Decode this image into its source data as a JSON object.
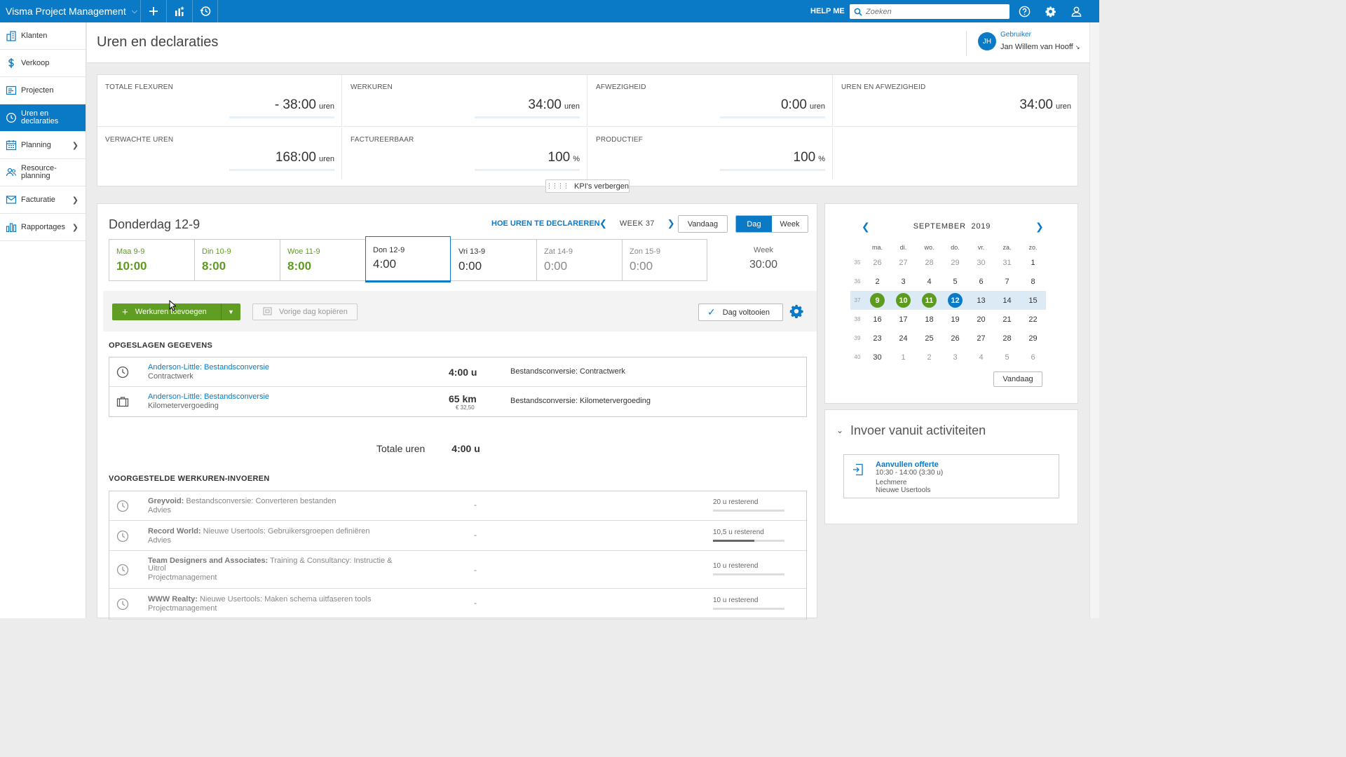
{
  "app": {
    "title": "Visma Project Management",
    "help": "HELP ME",
    "search_placeholder": "Zoeken"
  },
  "sidebar": {
    "items": [
      {
        "label": "Klanten",
        "icon": "building-icon"
      },
      {
        "label": "Verkoop",
        "icon": "dollar-icon"
      },
      {
        "label": "Projecten",
        "icon": "project-icon"
      },
      {
        "label": "Uren en declaraties",
        "icon": "clock-icon",
        "active": true
      },
      {
        "label": "Planning",
        "icon": "calendar-icon",
        "has_sub": true
      },
      {
        "label": "Resource-planning",
        "icon": "people-icon"
      },
      {
        "label": "Facturatie",
        "icon": "invoice-icon",
        "has_sub": true
      },
      {
        "label": "Rapportages",
        "icon": "chart-icon",
        "has_sub": true
      }
    ]
  },
  "header": {
    "title": "Uren en declaraties",
    "user_role": "Gebruiker",
    "user_name": "Jan Willem van Hooff",
    "initials": "JH"
  },
  "kpis": [
    {
      "label": "TOTALE FLEXUREN",
      "value": "- 38:00",
      "unit": "uren"
    },
    {
      "label": "WERKUREN",
      "value": "34:00",
      "unit": "uren"
    },
    {
      "label": "AFWEZIGHEID",
      "value": "0:00",
      "unit": "uren"
    },
    {
      "label": "UREN EN AFWEZIGHEID",
      "value": "34:00",
      "unit": "uren"
    },
    {
      "label": "VERWACHTE UREN",
      "value": "168:00",
      "unit": "uren"
    },
    {
      "label": "FACTUREERBAAR",
      "value": "100",
      "unit": "%"
    },
    {
      "label": "PRODUCTIEF",
      "value": "100",
      "unit": "%"
    }
  ],
  "kpi_toggle": "KPI's verbergen",
  "day": {
    "title": "Donderdag 12-9",
    "how_link": "HOE UREN TE DECLAREREN",
    "week_label": "WEEK 37",
    "today_btn": "Vandaag",
    "view_day": "Dag",
    "view_week": "Week",
    "days": [
      {
        "label": "Maa 9-9",
        "value": "10:00",
        "state": "green"
      },
      {
        "label": "Din 10-9",
        "value": "8:00",
        "state": "green"
      },
      {
        "label": "Woe 11-9",
        "value": "8:00",
        "state": "green"
      },
      {
        "label": "Don 12-9",
        "value": "4:00",
        "state": "sel"
      },
      {
        "label": "Vri 13-9",
        "value": "0:00",
        "state": "normal"
      },
      {
        "label": "Zat 14-9",
        "value": "0:00",
        "state": "grey"
      },
      {
        "label": "Zon 15-9",
        "value": "0:00",
        "state": "grey"
      }
    ],
    "week_total_label": "Week",
    "week_total": "30:00"
  },
  "actions": {
    "add": "Werkuren toevoegen",
    "copy": "Vorige dag kopiëren",
    "complete": "Dag voltooien"
  },
  "saved": {
    "title": "OPGESLAGEN GEGEVENS",
    "rows": [
      {
        "title": "Anderson-Little: Bestandsconversie",
        "sub": "Contractwerk",
        "value": "4:00 u",
        "desc": "Bestandsconversie: Contractwerk",
        "icon": "clock-icon"
      },
      {
        "title": "Anderson-Little: Bestandsconversie",
        "sub": "Kilometervergoeding",
        "value": "65 km",
        "small": "€ 32,50",
        "desc": "Bestandsconversie: Kilometervergoeding",
        "icon": "briefcase-icon"
      }
    ],
    "total_label": "Totale uren",
    "total_value": "4:00 u"
  },
  "suggested": {
    "title": "VOORGESTELDE WERKUREN-INVOEREN",
    "rows": [
      {
        "client": "Greyvoid:",
        "project": " Bestandsconversie: Converteren bestanden",
        "sub": "Advies",
        "dash": "-",
        "remaining": "20 u resterend",
        "progress": 0
      },
      {
        "client": "Record World:",
        "project": " Nieuwe Usertools: Gebruikersgroepen definiëren",
        "sub": "Advies",
        "dash": "-",
        "remaining": "10,5 u resterend",
        "progress": 0.58
      },
      {
        "client": "Team Designers and Associates:",
        "project": " Training & Consultancy: Instructie & Uitrol",
        "sub": "Projectmanagement",
        "dash": "-",
        "remaining": "10 u resterend",
        "progress": 0
      },
      {
        "client": "WWW Realty:",
        "project": " Nieuwe Usertools: Maken schema uitfaseren tools",
        "sub": "Projectmanagement",
        "dash": "-",
        "remaining": "10 u resterend",
        "progress": 0
      }
    ]
  },
  "calendar": {
    "month": "SEPTEMBER",
    "year": "2019",
    "weekdays": [
      "ma.",
      "di.",
      "wo.",
      "do.",
      "vr.",
      "za.",
      "zo."
    ],
    "weeks": [
      {
        "wk": "35",
        "days": [
          "26",
          "27",
          "28",
          "29",
          "30",
          "31",
          "1"
        ],
        "dim": [
          true,
          true,
          true,
          true,
          true,
          true,
          false
        ]
      },
      {
        "wk": "36",
        "days": [
          "2",
          "3",
          "4",
          "5",
          "6",
          "7",
          "8"
        ],
        "dim": [
          false,
          false,
          false,
          false,
          false,
          false,
          false
        ]
      },
      {
        "wk": "37",
        "days": [
          "9",
          "10",
          "11",
          "12",
          "13",
          "14",
          "15"
        ],
        "dim": [
          false,
          false,
          false,
          false,
          false,
          false,
          false
        ],
        "marks": [
          "g",
          "g",
          "g",
          "b",
          "",
          "",
          ""
        ]
      },
      {
        "wk": "38",
        "days": [
          "16",
          "17",
          "18",
          "19",
          "20",
          "21",
          "22"
        ],
        "dim": [
          false,
          false,
          false,
          false,
          false,
          false,
          false
        ]
      },
      {
        "wk": "39",
        "days": [
          "23",
          "24",
          "25",
          "26",
          "27",
          "28",
          "29"
        ],
        "dim": [
          false,
          false,
          false,
          false,
          false,
          false,
          false
        ]
      },
      {
        "wk": "40",
        "days": [
          "30",
          "1",
          "2",
          "3",
          "4",
          "5",
          "6"
        ],
        "dim": [
          false,
          true,
          true,
          true,
          true,
          true,
          true
        ]
      }
    ],
    "today_btn": "Vandaag"
  },
  "activities": {
    "title": "Invoer vanuit activiteiten",
    "card": {
      "title": "Aanvullen offerte",
      "time": "10:30 - 14:00 (3:30 u)",
      "client": "Lechmere",
      "project": "Nieuwe Usertools"
    }
  },
  "colors": {
    "brand": "#0a7ac7",
    "green": "#5c9b1d"
  }
}
